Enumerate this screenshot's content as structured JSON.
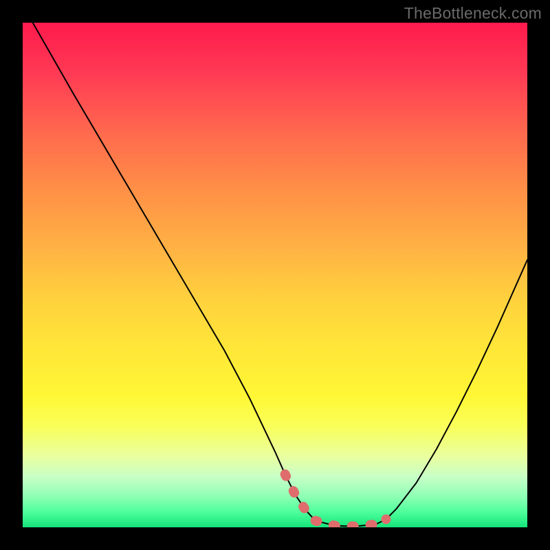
{
  "watermark": "TheBottleneck.com",
  "chart_data": {
    "type": "line",
    "title": "",
    "xlabel": "",
    "ylabel": "",
    "xlim": [
      0,
      100
    ],
    "ylim": [
      0,
      100
    ],
    "grid": false,
    "legend": false,
    "series": [
      {
        "name": "curve",
        "color": "#000000",
        "x": [
          2,
          6,
          10,
          15,
          20,
          25,
          30,
          35,
          40,
          45,
          50,
          52,
          54,
          56,
          58,
          62,
          66,
          70,
          72,
          74,
          78,
          82,
          86,
          90,
          94,
          98,
          100
        ],
        "y": [
          100,
          93,
          86,
          77.5,
          69,
          60.5,
          52,
          43.5,
          35,
          25.5,
          15,
          10.5,
          6.5,
          3.5,
          1.3,
          0.3,
          0.2,
          0.6,
          1.6,
          3.6,
          8.8,
          15.5,
          23,
          31,
          39.5,
          48.5,
          53
        ]
      },
      {
        "name": "highlight",
        "color": "#de6d6c",
        "x": [
          52,
          54,
          56,
          58,
          62,
          66,
          70,
          72
        ],
        "y": [
          10.5,
          6.5,
          3.5,
          1.3,
          0.3,
          0.2,
          0.6,
          1.6
        ]
      }
    ]
  }
}
